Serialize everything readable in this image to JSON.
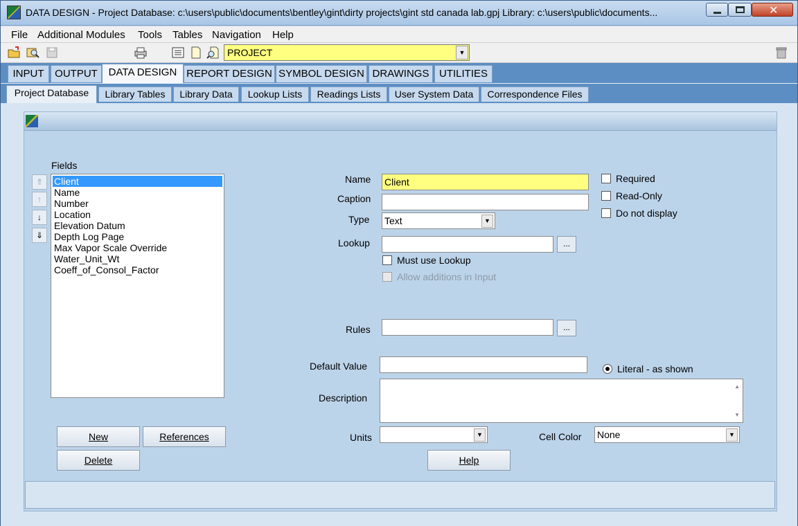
{
  "titlebar": {
    "title": "DATA DESIGN -  Project Database:  c:\\users\\public\\documents\\bentley\\gint\\dirty projects\\gint std canada lab.gpj  Library: c:\\users\\public\\documents..."
  },
  "menu": [
    "File",
    "Additional Modules",
    "Tools",
    "Tables",
    "Navigation",
    "Help"
  ],
  "toolbar": {
    "icons": [
      "open-folder-icon",
      "search-icon",
      "save-icon",
      "print-icon",
      "list-icon",
      "new-document-icon",
      "find-document-icon",
      "trash-icon"
    ],
    "table_combo_value": "PROJECT"
  },
  "tabs_main": [
    "INPUT",
    "OUTPUT",
    "DATA DESIGN",
    "REPORT DESIGN",
    "SYMBOL DESIGN",
    "DRAWINGS",
    "UTILITIES"
  ],
  "tabs_sub": [
    "Project Database",
    "Library Tables",
    "Library Data",
    "Lookup Lists",
    "Readings Lists",
    "User System Data",
    "Correspondence Files"
  ],
  "fields": {
    "label": "Fields",
    "items": [
      "Client",
      "Name",
      "Number",
      "Location",
      "Elevation Datum",
      "Depth Log Page",
      "Max Vapor Scale Override",
      "Water_Unit_Wt",
      "Coeff_of_Consol_Factor"
    ],
    "selected": "Client"
  },
  "form": {
    "name_label": "Name",
    "name_value": "Client",
    "caption_label": "Caption",
    "caption_value": "",
    "type_label": "Type",
    "type_value": "Text",
    "lookup_label": "Lookup",
    "lookup_value": "",
    "must_use_lookup": "Must use Lookup",
    "allow_additions": "Allow additions in Input",
    "rules_label": "Rules",
    "rules_value": "",
    "default_value_label": "Default Value",
    "default_value": "",
    "literal_label": "Literal - as shown",
    "description_label": "Description",
    "description_value": "",
    "units_label": "Units",
    "units_value": "",
    "cell_color_label": "Cell Color",
    "cell_color_value": "None",
    "dots": "...",
    "required": "Required",
    "read_only": "Read-Only",
    "do_not_display": "Do not display"
  },
  "buttons": {
    "new": "New",
    "references": "References",
    "delete": "Delete",
    "help": "Help"
  },
  "colors": {
    "field_yellow": "#ffff80",
    "selection_blue": "#3399ff",
    "tab_strip": "#5d8ec3"
  }
}
